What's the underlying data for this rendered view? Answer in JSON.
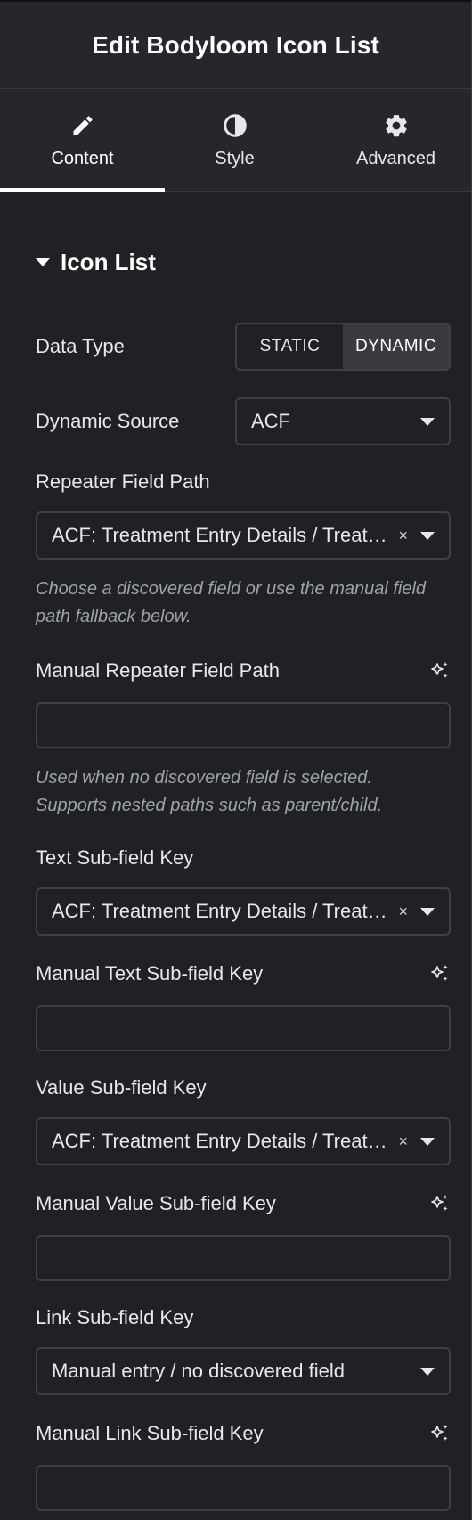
{
  "header": {
    "title": "Edit Bodyloom Icon List"
  },
  "tabs": [
    {
      "label": "Content",
      "icon": "pencil-icon",
      "active": true
    },
    {
      "label": "Style",
      "icon": "half-circle-icon",
      "active": false
    },
    {
      "label": "Advanced",
      "icon": "gear-icon",
      "active": false
    }
  ],
  "section": {
    "title": "Icon List"
  },
  "data_type": {
    "label": "Data Type",
    "options": [
      "STATIC",
      "DYNAMIC"
    ],
    "selected": "DYNAMIC"
  },
  "dynamic_source": {
    "label": "Dynamic Source",
    "value": "ACF"
  },
  "repeater_field": {
    "label": "Repeater Field Path",
    "value": "ACF: Treatment Entry Details / Treatment Entry Details",
    "help": "Choose a discovered field or use the manual field path fallback below."
  },
  "manual_repeater": {
    "label": "Manual Repeater Field Path",
    "value": "",
    "help": "Used when no discovered field is selected. Supports nested paths such as parent/child."
  },
  "text_subfield": {
    "label": "Text Sub-field Key",
    "value": "ACF: Treatment Entry Details / Treatment Entry Details"
  },
  "manual_text_subfield": {
    "label": "Manual Text Sub-field Key",
    "value": ""
  },
  "value_subfield": {
    "label": "Value Sub-field Key",
    "value": "ACF: Treatment Entry Details / Treatment Entry Details"
  },
  "manual_value_subfield": {
    "label": "Manual Value Sub-field Key",
    "value": ""
  },
  "link_subfield": {
    "label": "Link Sub-field Key",
    "value": "Manual entry / no discovered field"
  },
  "manual_link_subfield": {
    "label": "Manual Link Sub-field Key",
    "value": ""
  },
  "icons": {
    "clear": "×",
    "ai": "sparkle-icon"
  },
  "colors": {
    "background": "#202124",
    "header": "#26272b",
    "border": "#3f4045",
    "active_tab_underline": "#ffffff",
    "help_text": "#9fa3a8"
  }
}
